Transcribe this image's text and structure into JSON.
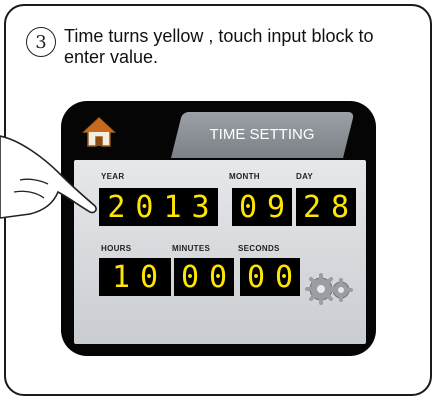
{
  "step": {
    "number": "3",
    "text": "Time turns yellow , touch input block to enter value."
  },
  "screen": {
    "tab_title": "TIME SETTING",
    "fields": {
      "year": {
        "label": "YEAR",
        "value": "2013"
      },
      "month": {
        "label": "MONTH",
        "value": "09"
      },
      "day": {
        "label": "DAY",
        "value": "28"
      },
      "hours": {
        "label": "HOURS",
        "value": "10"
      },
      "minutes": {
        "label": "MINUTES",
        "value": "00"
      },
      "seconds": {
        "label": "SECONDS",
        "value": "00"
      }
    }
  },
  "icons": [
    "home-icon",
    "settings-gears-icon",
    "pointing-hand-icon"
  ],
  "colors": {
    "digit": "#ffe600",
    "tab": "#8a9096",
    "panel": "#d6d9dc",
    "bezel": "#050505"
  }
}
